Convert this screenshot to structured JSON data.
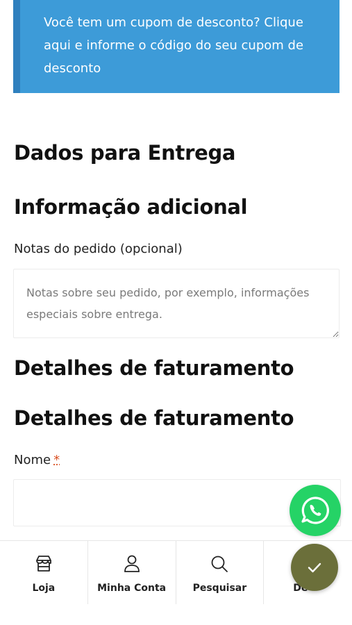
{
  "coupon": {
    "text": "Você tem um cupom de desconto? Clique aqui e informe o código do seu cupom de desconto"
  },
  "sections": {
    "delivery_title": "Dados para Entrega",
    "additional_info_title": "Informação adicional",
    "billing_title_1": "Detalhes de faturamento",
    "billing_title_2": "Detalhes de faturamento"
  },
  "order_notes": {
    "label": "Notas do pedido (opcional)",
    "placeholder": "Notas sobre seu pedido, por exemplo, informações especiais sobre entrega."
  },
  "name_field": {
    "label": "Nome",
    "required_marker": "*",
    "value": ""
  },
  "bottom_nav": {
    "items": [
      {
        "label": "Loja",
        "icon": "store-icon"
      },
      {
        "label": "Minha Conta",
        "icon": "user-icon"
      },
      {
        "label": "Pesquisar",
        "icon": "search-icon"
      },
      {
        "label": "De",
        "icon": ""
      }
    ]
  },
  "floating": {
    "whatsapp_icon": "whatsapp-icon",
    "confirm_icon": "checkmark-icon"
  },
  "colors": {
    "coupon_bg": "#3d9bd8",
    "whatsapp": "#25d366",
    "confirm": "#6b6f3a",
    "required": "#d94d1f"
  }
}
